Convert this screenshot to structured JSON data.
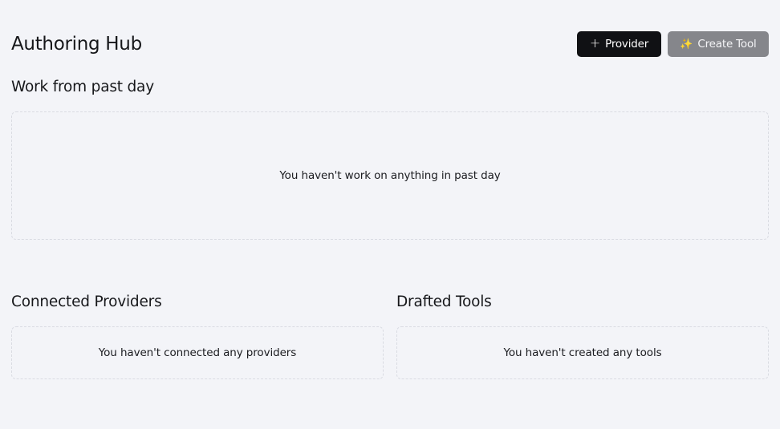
{
  "header": {
    "title": "Authoring Hub",
    "buttons": {
      "provider": {
        "icon": "plus-icon",
        "icon_glyph": "+",
        "label": "Provider"
      },
      "create_tool": {
        "icon": "sparkle-icon",
        "icon_glyph": "✨",
        "label": "Create Tool"
      }
    }
  },
  "sections": {
    "work": {
      "title": "Work from past day",
      "empty_message": "You haven't work on anything in past day"
    },
    "providers": {
      "title": "Connected Providers",
      "empty_message": "You haven't connected any providers"
    },
    "tools": {
      "title": "Drafted Tools",
      "empty_message": "You haven't created any tools"
    }
  },
  "colors": {
    "background": "#f3f4f8",
    "primary_button": "#101114",
    "secondary_button": "#85868b",
    "dashed_border": "#d9dbe2"
  }
}
